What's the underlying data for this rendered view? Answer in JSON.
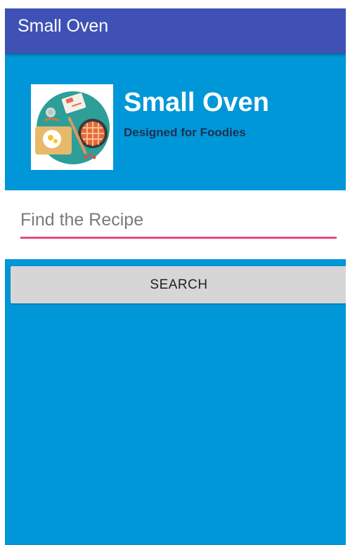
{
  "app_bar": {
    "title": "Small Oven"
  },
  "header": {
    "brand_title": "Small Oven",
    "tagline": "Designed for Foodies",
    "logo_icon": "kitchen-table-illustration-icon"
  },
  "search": {
    "placeholder": "Find the Recipe",
    "value": "",
    "button_label": "SEARCH"
  },
  "colors": {
    "app_bar": "#3f51b5",
    "background": "#0097d8",
    "accent_underline": "#e24a87",
    "button": "#d6d6d6"
  }
}
